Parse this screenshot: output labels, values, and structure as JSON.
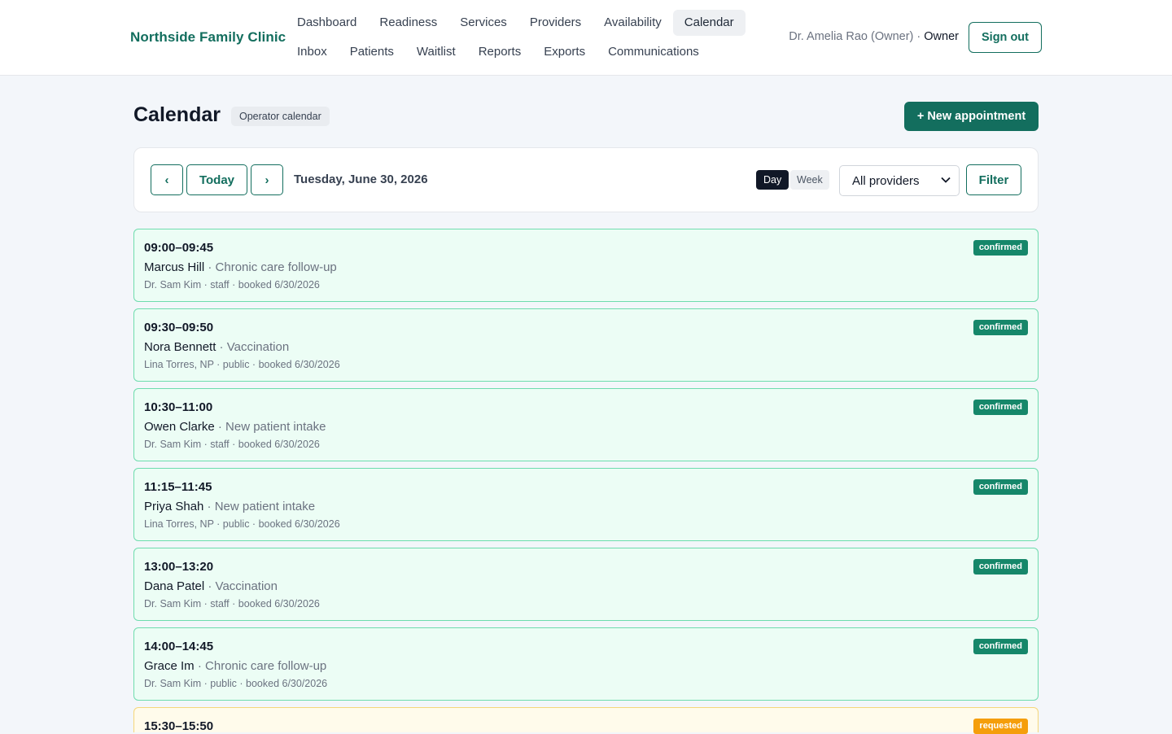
{
  "header": {
    "brand": "Northside Family Clinic",
    "nav_row1": [
      "Dashboard",
      "Readiness",
      "Services",
      "Providers",
      "Availability",
      "Calendar"
    ],
    "nav_row2": [
      "Inbox",
      "Patients",
      "Waitlist",
      "Reports",
      "Exports",
      "Communications"
    ],
    "active_nav": "Calendar",
    "user_name": "Dr. Amelia Rao (Owner)",
    "user_sep": " · ",
    "user_role": "Owner",
    "sign_out": "Sign out"
  },
  "page": {
    "title": "Calendar",
    "badge": "Operator calendar",
    "new_appointment": "+ New appointment"
  },
  "toolbar": {
    "prev": "‹",
    "today": "Today",
    "next": "›",
    "date": "Tuesday, June 30, 2026",
    "view_day": "Day",
    "view_week": "Week",
    "provider_select": "All providers",
    "filter": "Filter"
  },
  "appointments": [
    {
      "time": "09:00–09:45",
      "patient": "Marcus Hill",
      "service": " · Chronic care follow-up",
      "meta": "Dr. Sam Kim · staff · booked 6/30/2026",
      "status": "confirmed"
    },
    {
      "time": "09:30–09:50",
      "patient": "Nora Bennett",
      "service": " · Vaccination",
      "meta": "Lina Torres, NP · public · booked 6/30/2026",
      "status": "confirmed"
    },
    {
      "time": "10:30–11:00",
      "patient": "Owen Clarke",
      "service": " · New patient intake",
      "meta": "Dr. Sam Kim · staff · booked 6/30/2026",
      "status": "confirmed"
    },
    {
      "time": "11:15–11:45",
      "patient": "Priya Shah",
      "service": " · New patient intake",
      "meta": "Lina Torres, NP · public · booked 6/30/2026",
      "status": "confirmed"
    },
    {
      "time": "13:00–13:20",
      "patient": "Dana Patel",
      "service": " · Vaccination",
      "meta": "Dr. Sam Kim · staff · booked 6/30/2026",
      "status": "confirmed"
    },
    {
      "time": "14:00–14:45",
      "patient": "Grace Im",
      "service": " · Chronic care follow-up",
      "meta": "Dr. Sam Kim · public · booked 6/30/2026",
      "status": "confirmed"
    },
    {
      "time": "15:30–15:50",
      "patient": "",
      "service": "",
      "meta": "",
      "status": "requested"
    }
  ],
  "colors": {
    "accent": "#136e5e",
    "confirmed_bg": "#ecfdf5",
    "confirmed_border": "#6fdcae",
    "requested_bg": "#fffbeb",
    "requested_border": "#f5d77a"
  }
}
